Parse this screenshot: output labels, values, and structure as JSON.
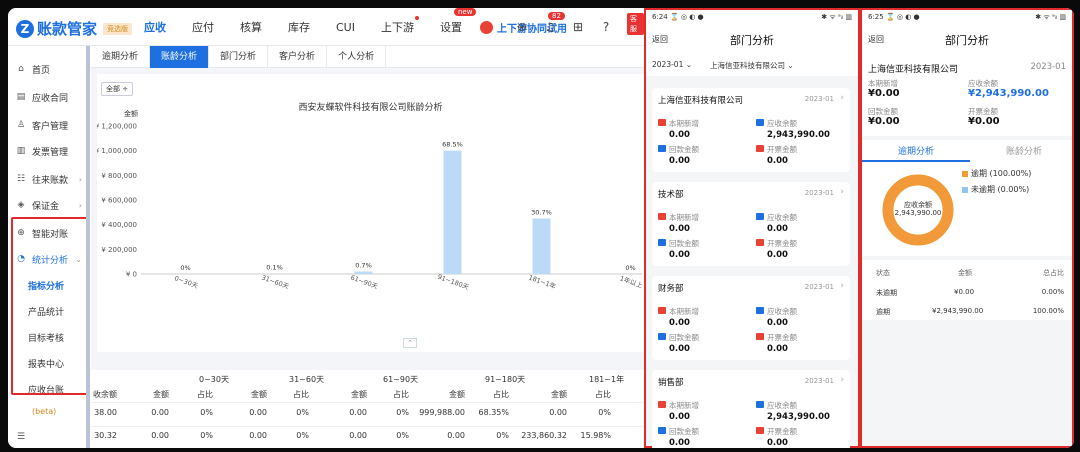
{
  "app": {
    "name": "账款管家",
    "logo_letter": "Z",
    "plan_badge": "竞选版"
  },
  "nav": {
    "items": [
      "应收",
      "应付",
      "核算",
      "库存",
      "CUI",
      "上下游",
      "设置"
    ],
    "active": "应收",
    "new_badge": "new",
    "collab": "上下游协同试用",
    "message_count": "82",
    "service_badge": "客服"
  },
  "sidebar": {
    "items": [
      {
        "label": "首页",
        "icon": "home-icon",
        "glyph": "⌂"
      },
      {
        "label": "应收合同",
        "icon": "contract-icon",
        "glyph": "▤"
      },
      {
        "label": "客户管理",
        "icon": "user-icon",
        "glyph": "♙"
      },
      {
        "label": "发票管理",
        "icon": "invoice-icon",
        "glyph": "▥"
      },
      {
        "label": "往来账款",
        "icon": "ledger-icon",
        "glyph": "☷"
      },
      {
        "label": "保证金",
        "icon": "deposit-icon",
        "glyph": "◈"
      },
      {
        "label": "智能对账",
        "icon": "reconcile-icon",
        "glyph": "⊕"
      },
      {
        "label": "统计分析",
        "icon": "stats-icon",
        "glyph": "◔"
      }
    ],
    "sub_items": [
      "指标分析",
      "产品统计",
      "目标考核",
      "报表中心",
      "应收台账"
    ],
    "beta_label": "(beta)"
  },
  "tabs": [
    "逾期分析",
    "账龄分析",
    "部门分析",
    "客户分析",
    "个人分析"
  ],
  "active_tab": "账龄分析",
  "chart_filter": "全部 ÷",
  "chart_data": {
    "type": "bar",
    "title": "西安友蝶软件科技有限公司账龄分析",
    "ylabel": "金额",
    "categories": [
      "0~30天",
      "31~60天",
      "61~90天",
      "91~180天",
      "181~1年",
      "1年以上"
    ],
    "values": [
      0,
      3000,
      20000,
      999988,
      450000,
      0
    ],
    "data_labels": [
      "0%",
      "0.1%",
      "0.7%",
      "68.5%",
      "30.7%",
      "0%"
    ],
    "yticks": [
      "¥ 0",
      "¥ 200,000",
      "¥ 400,000",
      "¥ 600,000",
      "¥ 800,000",
      "¥ 1,000,000",
      "¥ 1,200,000"
    ],
    "ylim": [
      0,
      1200000
    ],
    "color": "#bcd9f8"
  },
  "table": {
    "group_headers": [
      "0~30天",
      "31~60天",
      "61~90天",
      "91~180天",
      "181~1年"
    ],
    "sub_headers": [
      "收余额",
      "金额",
      "占比",
      "金额",
      "占比",
      "金额",
      "占比",
      "金额",
      "占比",
      "金额",
      "占比"
    ],
    "rows": [
      [
        "38.00",
        "0.00",
        "0%",
        "0.00",
        "0%",
        "0.00",
        "0%",
        "999,988.00",
        "68.35%",
        "0.00",
        "0%"
      ],
      [
        "30.32",
        "0.00",
        "0%",
        "0.00",
        "0%",
        "0.00",
        "0%",
        "0.00",
        "0%",
        "233,860.32",
        "15.98%"
      ]
    ]
  },
  "phone1": {
    "status_time": "6:24 ⌛ ◎ ◐ ●",
    "status_right": "✱ ᯤ ᵃᵢₗ ▥",
    "back": "返回",
    "title": "部门分析",
    "filter_period": "2023-01 ⌄",
    "filter_company": "上海信亚科技有限公司 ⌄",
    "cards": [
      {
        "name": "上海信亚科技有限公司",
        "period": "2023-01",
        "new": "0.00",
        "recv": "2,943,990.00",
        "back": "0.00",
        "invoice": "0.00"
      },
      {
        "name": "技术部",
        "period": "2023-01",
        "new": "0.00",
        "recv": "0.00",
        "back": "0.00",
        "invoice": "0.00"
      },
      {
        "name": "财务部",
        "period": "2023-01",
        "new": "0.00",
        "recv": "0.00",
        "back": "0.00",
        "invoice": "0.00"
      },
      {
        "name": "销售部",
        "period": "2023-01",
        "new": "0.00",
        "recv": "2,943,990.00",
        "back": "0.00",
        "invoice": "0.00"
      }
    ],
    "labels": {
      "new": "本期新增",
      "recv": "应收余额",
      "back": "回款金额",
      "invoice": "开票金额"
    }
  },
  "phone2": {
    "status_time": "6:25 ⌛ ◎ ◐ ●",
    "status_right": "✱ ᯤ ᵃᵢₗ ▥",
    "back": "返回",
    "title": "部门分析",
    "company": "上海信亚科技有限公司",
    "period": "2023-01",
    "labels": {
      "new": "本期新增",
      "recv": "应收余额",
      "back": "回款金额",
      "invoice": "开票金额"
    },
    "values": {
      "new": "¥0.00",
      "recv": "¥2,943,990.00",
      "back": "¥0.00",
      "invoice": "¥0.00"
    },
    "segments": [
      "逾期分析",
      "账龄分析"
    ],
    "donut_label": "应收余额",
    "donut_value": "2,943,990.00",
    "legend": [
      {
        "label": "逾期 (100.00%)",
        "color": "#f29a3a",
        "fraction": 1.0
      },
      {
        "label": "未逾期 (0.00%)",
        "color": "#8ec4f0",
        "fraction": 0.0
      }
    ],
    "table": {
      "headers": [
        "状态",
        "金额",
        "总占比"
      ],
      "rows": [
        [
          "未逾期",
          "¥0.00",
          "0.00%"
        ],
        [
          "逾期",
          "¥2,943,990.00",
          "100.00%"
        ]
      ]
    }
  }
}
